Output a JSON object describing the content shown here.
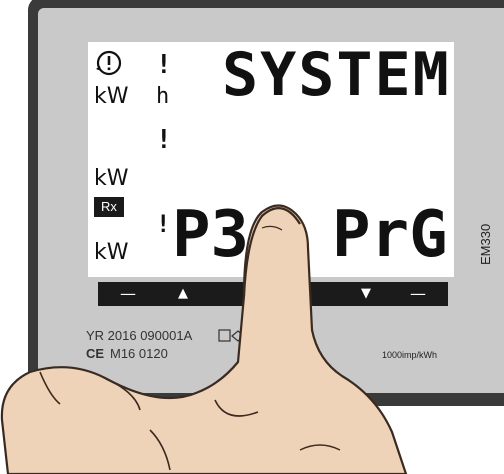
{
  "display": {
    "line1": "SYSTEM",
    "line2_left": "P3",
    "line2_right": "PrG",
    "unit_top": "kW",
    "unit_mid": "kW",
    "unit_bottom": "kW",
    "rx_label": "Rx",
    "h_marker": "h",
    "excl1": "!",
    "excl2": "!",
    "excl3": "!"
  },
  "buttons": {
    "minus_left": "—",
    "up": "▲",
    "enter": "↵",
    "down": "▼",
    "minus_right": "—"
  },
  "labels": {
    "model": "EM330",
    "yr": "YR 2016 090001A",
    "mid": "M16 0120",
    "ce": "CE",
    "imp": "1000imp/kWh"
  },
  "icons": {
    "alarm": "alarm-cycle-icon",
    "meter": "meter-symbol-icon"
  },
  "colors": {
    "housing": "#3a3a3a",
    "bezel": "#c9c9c9",
    "lcd": "#ffffff",
    "bar": "#1b1b1b",
    "skin": "#e8c8a8"
  }
}
